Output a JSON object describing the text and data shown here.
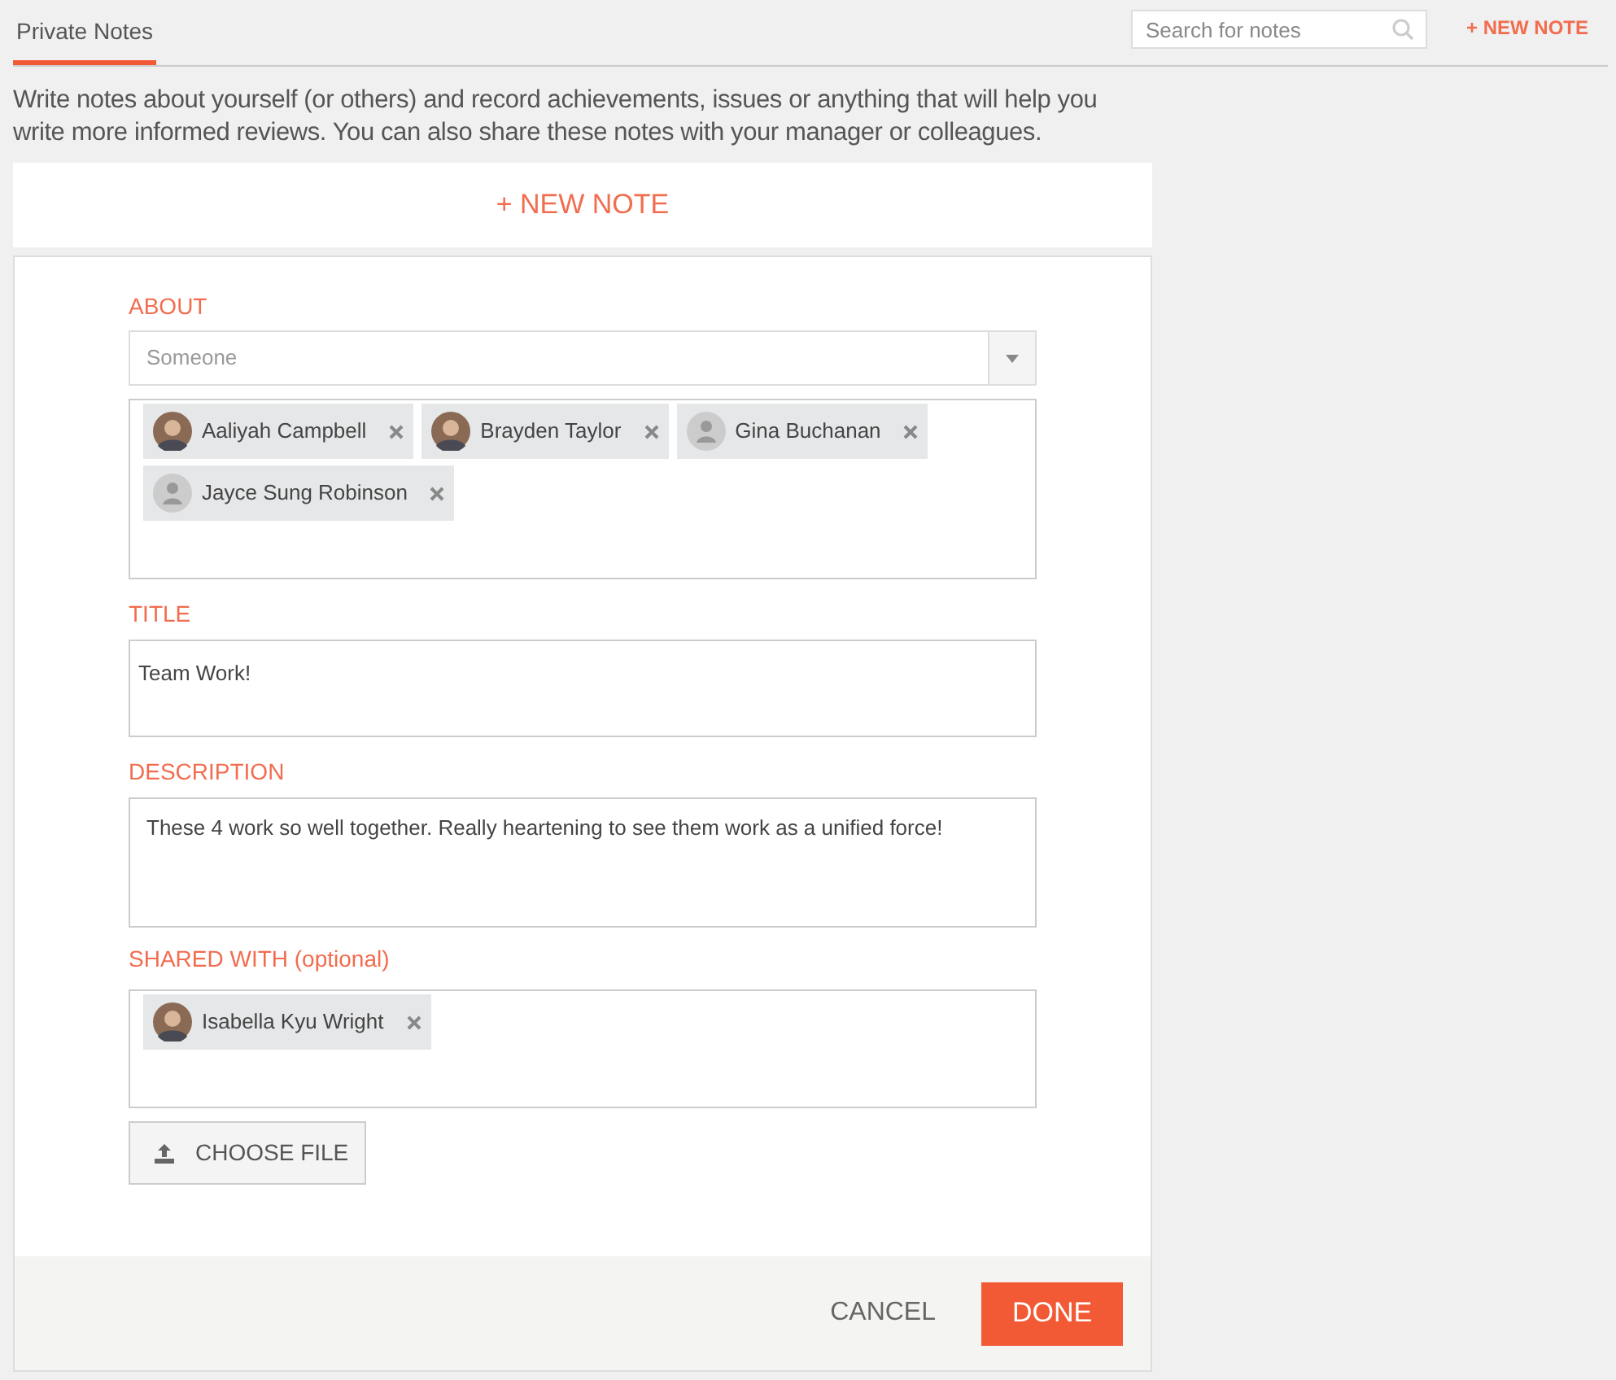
{
  "tabs": [
    {
      "label": "Private Notes",
      "selected": true
    }
  ],
  "search": {
    "placeholder": "Search for notes"
  },
  "header_action": "+ NEW NOTE",
  "intro": "Write notes about yourself (or others) and record achievements, issues or anything that will help you write more informed reviews. You can also share these notes with your manager or colleagues.",
  "new_note_button": "+ NEW NOTE",
  "form": {
    "about": {
      "label": "ABOUT",
      "select_value": "Someone",
      "people": [
        {
          "name": "Aaliyah Campbell",
          "kind": "photo"
        },
        {
          "name": "Brayden Taylor",
          "kind": "photo"
        },
        {
          "name": "Gina Buchanan",
          "kind": "placeholder"
        },
        {
          "name": "Jayce Sung Robinson",
          "kind": "placeholder"
        }
      ]
    },
    "title": {
      "label": "TITLE",
      "value": "Team Work!"
    },
    "description": {
      "label": "DESCRIPTION",
      "value": "These 4 work so well together. Really heartening to see them work as a unified force!"
    },
    "shared_with": {
      "label": "SHARED WITH (optional)",
      "people": [
        {
          "name": "Isabella Kyu Wright",
          "kind": "photo"
        }
      ]
    },
    "choose_file": "CHOOSE FILE"
  },
  "footer": {
    "cancel": "CANCEL",
    "done": "DONE"
  }
}
